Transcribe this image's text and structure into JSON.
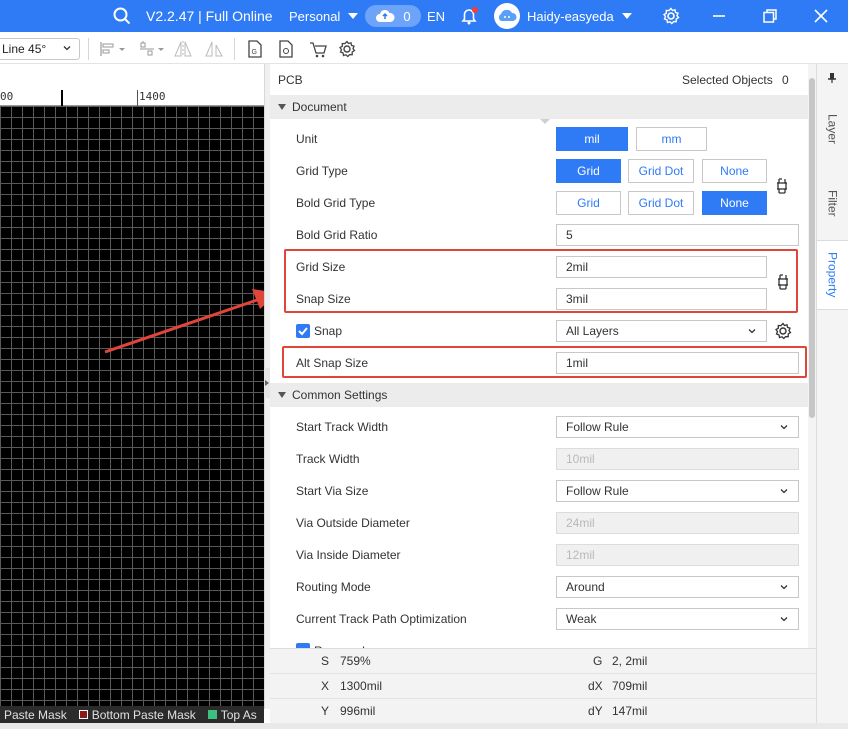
{
  "titlebar": {
    "version": "V2.2.47 | Full Online",
    "workspace": "Personal",
    "cloud_count": "0",
    "language": "EN",
    "username": "Haidy-easyeda"
  },
  "toolbar": {
    "route_mode": "Line 45°"
  },
  "ruler": {
    "tick_left": "00",
    "tick_right": "1400"
  },
  "statusbar": {
    "layers": [
      {
        "label": "Paste Mask",
        "color": ""
      },
      {
        "label": "Bottom Paste Mask",
        "color": "#8b1a1a"
      },
      {
        "label": "Top As",
        "color": "#3fbf7f"
      }
    ]
  },
  "panel": {
    "title": "PCB",
    "selected_label": "Selected Objects",
    "selected_count": "0",
    "document": {
      "header": "Document",
      "unit_label": "Unit",
      "unit_options": [
        "mil",
        "mm"
      ],
      "unit_selected": "mil",
      "grid_type_label": "Grid Type",
      "grid_type_options": [
        "Grid",
        "Grid Dot",
        "None"
      ],
      "grid_type_selected": "Grid",
      "bold_grid_type_label": "Bold Grid Type",
      "bold_grid_type_options": [
        "Grid",
        "Grid Dot",
        "None"
      ],
      "bold_grid_type_selected": "None",
      "bold_grid_ratio_label": "Bold Grid Ratio",
      "bold_grid_ratio_value": "5",
      "grid_size_label": "Grid Size",
      "grid_size_value": "2mil",
      "snap_size_label": "Snap Size",
      "snap_size_value": "3mil",
      "snap_label": "Snap",
      "snap_checked": true,
      "snap_layer": "All Layers",
      "alt_snap_label": "Alt Snap Size",
      "alt_snap_value": "1mil"
    },
    "common": {
      "header": "Common Settings",
      "start_track_width_label": "Start Track Width",
      "start_track_width_value": "Follow Rule",
      "track_width_label": "Track Width",
      "track_width_value": "10mil",
      "start_via_size_label": "Start Via Size",
      "start_via_size_value": "Follow Rule",
      "via_outside_label": "Via Outside Diameter",
      "via_outside_value": "24mil",
      "via_inside_label": "Via Inside Diameter",
      "via_inside_value": "12mil",
      "routing_mode_label": "Routing Mode",
      "routing_mode_value": "Around",
      "track_opt_label": "Current Track Path Optimization",
      "track_opt_value": "Weak",
      "remove_loop_label": "Remove Loop"
    }
  },
  "coords": {
    "s_label": "S",
    "s_value": "759%",
    "g_label": "G",
    "g_value": "2, 2mil",
    "x_label": "X",
    "x_value": "1300mil",
    "dx_label": "dX",
    "dx_value": "709mil",
    "y_label": "Y",
    "y_value": "996mil",
    "dy_label": "dY",
    "dy_value": "147mil"
  },
  "righttabs": {
    "layer": "Layer",
    "filter": "Filter",
    "property": "Property"
  },
  "colors": {
    "accent": "#2f7bf5",
    "highlight": "#e0453a"
  }
}
